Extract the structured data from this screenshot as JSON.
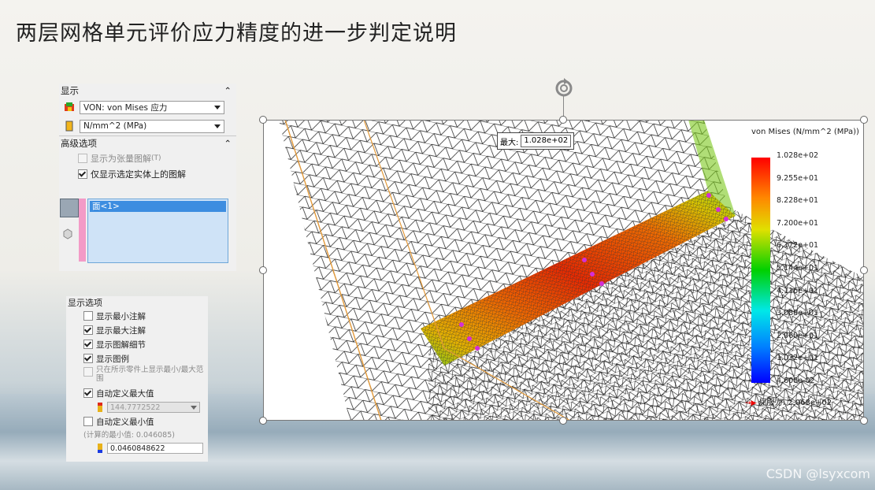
{
  "slide": {
    "title": "两层网格单元评价应力精度的进一步判定说明"
  },
  "display_panel": {
    "section_display": "显示",
    "stress_combo": "VON: von Mises 应力",
    "unit_combo": "N/mm^2 (MPa)",
    "section_advanced": "高级选项",
    "opt_tensor": "显示为张量图解",
    "opt_tensor_shortcut": "(T)",
    "opt_selected_only": "仅显示选定实体上的图解",
    "list_item": "面<1>"
  },
  "display_options": {
    "header": "显示选项",
    "show_min": "显示最小注解",
    "show_max": "显示最大注解",
    "show_detail": "显示图解细节",
    "show_legend": "显示图例",
    "show_range_part": "只在所示零件上显示最小/最大范围",
    "auto_max": "自动定义最大值",
    "max_value": "144.7772522",
    "auto_min": "自动定义最小值",
    "computed_min": "(计算的最小值: 0.046085)",
    "min_value": "0.0460848622"
  },
  "viewport": {
    "max_label": "最大:",
    "max_value": "1.028e+02",
    "legend_title": "von Mises (N/mm^2 (MPa))",
    "ticks": [
      "1.028e+02",
      "9.255e+01",
      "8.228e+01",
      "7.200e+01",
      "6.172e+01",
      "5.144e+01",
      "4.116e+01",
      "3.088e+01",
      "2.060e+01",
      "1.032e+01",
      "4.608e-02"
    ],
    "yield_label": "屈服力: 2.068e+02"
  },
  "colors": {
    "selection": "#3d8de0",
    "pink": "#f39bc7",
    "hot": "#ff2a00"
  },
  "watermark": "CSDN @lsyxcom"
}
